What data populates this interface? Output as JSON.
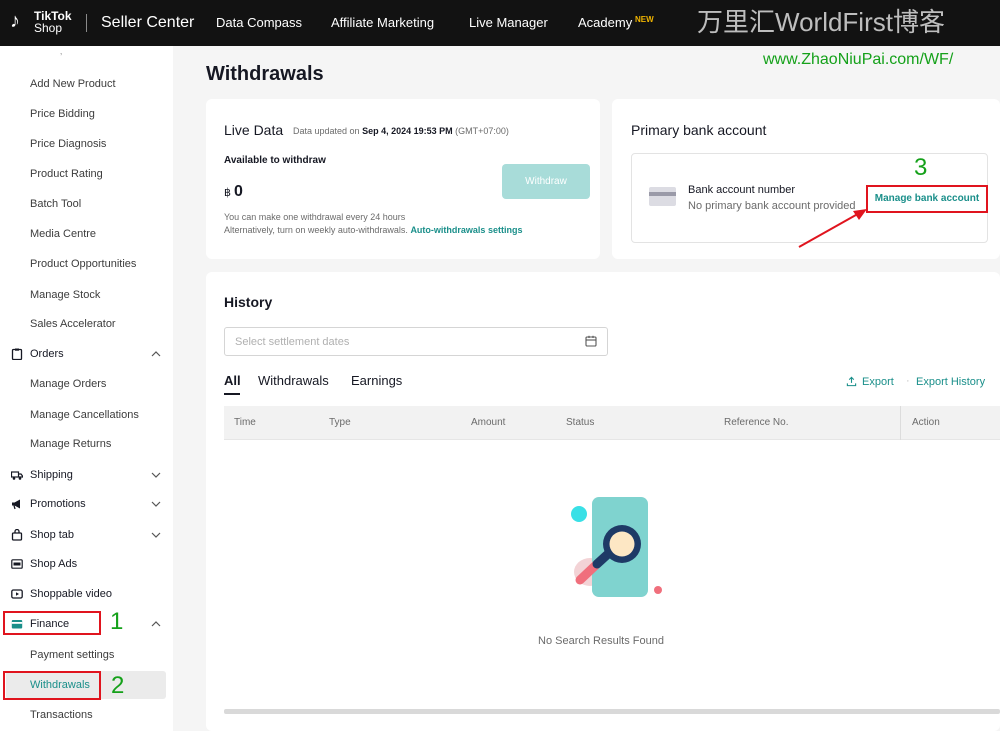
{
  "header": {
    "brand_line1": "TikTok",
    "brand_line2": "Shop",
    "app_title": "Seller Center",
    "nav": [
      "Data Compass",
      "Affiliate Marketing",
      "Live Manager",
      "Academy"
    ],
    "nav_badge": "NEW"
  },
  "watermark": {
    "title": "万里汇WorldFirst博客",
    "url": "www.ZhaoNiuPai.com/WF/"
  },
  "sidebar": {
    "product_items": [
      "Add New Product",
      "Price Bidding",
      "Price Diagnosis",
      "Product Rating",
      "Batch Tool",
      "Media Centre",
      "Product Opportunities",
      "Manage Stock",
      "Sales Accelerator"
    ],
    "orders": {
      "label": "Orders",
      "items": [
        "Manage Orders",
        "Manage Cancellations",
        "Manage Returns"
      ]
    },
    "shipping": "Shipping",
    "promotions": "Promotions",
    "shop_tab": "Shop tab",
    "shop_ads": "Shop Ads",
    "shoppable_video": "Shoppable video",
    "finance": {
      "label": "Finance",
      "items": [
        "Payment settings",
        "Withdrawals",
        "Transactions"
      ]
    }
  },
  "page": {
    "title": "Withdrawals"
  },
  "live_data": {
    "title": "Live Data",
    "updated_prefix": "Data updated on",
    "updated_time": "Sep 4, 2024 19:53 PM",
    "updated_tz": "(GMT+07:00)",
    "available_label": "Available to withdraw",
    "currency": "฿",
    "amount": "0",
    "withdraw_button": "Withdraw",
    "help_line1": "You can make one withdrawal every 24 hours",
    "help_line2_prefix": "Alternatively, turn on weekly auto-withdrawals.",
    "help_link": "Auto-withdrawals settings"
  },
  "bank": {
    "title": "Primary bank account",
    "number_label": "Bank account number",
    "no_account": "No primary bank account provided",
    "manage_button": "Manage bank account"
  },
  "history": {
    "title": "History",
    "date_placeholder": "Select settlement dates",
    "tabs": [
      "All",
      "Withdrawals",
      "Earnings"
    ],
    "export": "Export",
    "export_history": "Export History",
    "columns": [
      "Time",
      "Type",
      "Amount",
      "Status",
      "Reference No.",
      "Action"
    ],
    "empty_text": "No Search Results Found"
  },
  "annotations": {
    "step1": "1",
    "step2": "2",
    "step3": "3",
    "color_box": "#e0141e",
    "color_number": "#15a11a"
  },
  "colors": {
    "topbar": "#121212",
    "accent_teal": "#1a8f8a",
    "button_disabled": "#a8dcd9"
  },
  "icons": {
    "orders": "clipboard-icon",
    "shipping": "truck-icon",
    "promotions": "megaphone-icon",
    "shop_tab": "bag-icon",
    "shop_ads": "ads-icon",
    "shoppable_video": "video-icon",
    "finance": "wallet-icon"
  }
}
